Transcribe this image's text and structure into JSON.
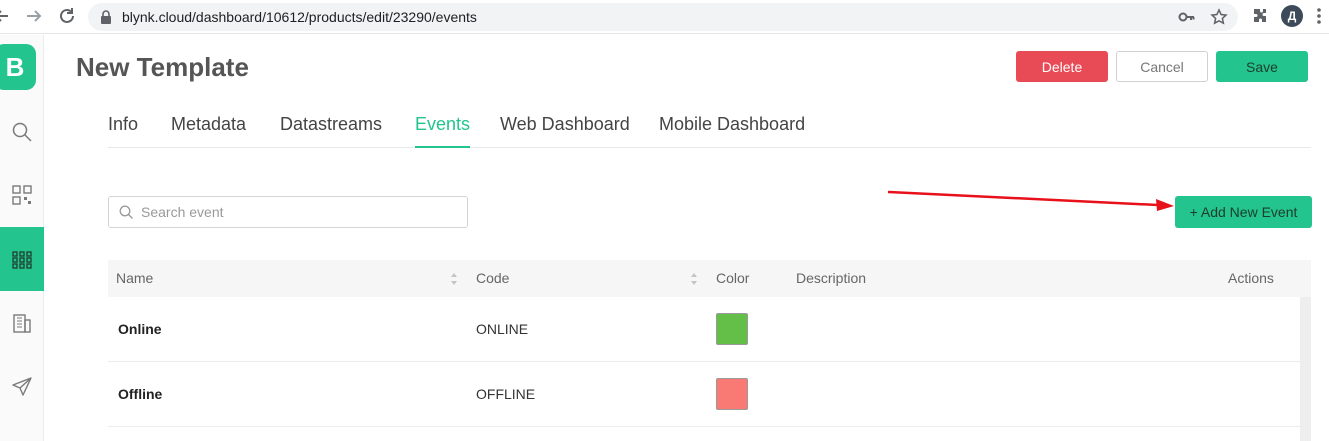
{
  "browser": {
    "url": "blynk.cloud/dashboard/10612/products/edit/23290/events",
    "profile_initial": "Д"
  },
  "sidebar": {
    "logo": "B",
    "items": [
      {
        "icon": "search-icon"
      },
      {
        "icon": "qr-code-icon"
      },
      {
        "icon": "grid-icon",
        "active": true
      },
      {
        "icon": "building-icon"
      },
      {
        "icon": "send-icon"
      }
    ]
  },
  "header": {
    "title": "New Template",
    "delete_label": "Delete",
    "cancel_label": "Cancel",
    "save_label": "Save"
  },
  "tabs": [
    {
      "label": "Info"
    },
    {
      "label": "Metadata"
    },
    {
      "label": "Datastreams"
    },
    {
      "label": "Events",
      "active": true
    },
    {
      "label": "Web Dashboard"
    },
    {
      "label": "Mobile Dashboard"
    }
  ],
  "search": {
    "placeholder": "Search event",
    "value": ""
  },
  "add_event_label": "+ Add New Event",
  "table": {
    "columns": {
      "name": "Name",
      "code": "Code",
      "color": "Color",
      "description": "Description",
      "actions": "Actions"
    },
    "rows": [
      {
        "name": "Online",
        "code": "ONLINE",
        "color": "#63bf47"
      },
      {
        "name": "Offline",
        "code": "OFFLINE",
        "color": "#f97a75"
      }
    ]
  },
  "colors": {
    "brand": "#23c48e",
    "danger": "#e84b56",
    "annotation_arrow": "#e8101a"
  }
}
